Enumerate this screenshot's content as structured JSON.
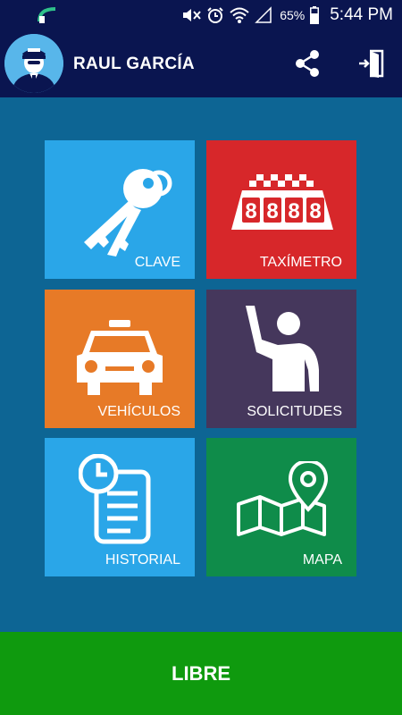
{
  "status_bar": {
    "battery": "65%",
    "time": "5:44 PM"
  },
  "header": {
    "user_name": "RAUL GARCÍA",
    "background": "#0a1550"
  },
  "tiles": [
    {
      "label": "CLAVE",
      "icon": "keys-icon",
      "color": "#2aa6e8"
    },
    {
      "label": "TAXÍMETRO",
      "icon": "taximeter-icon",
      "color": "#d7272a"
    },
    {
      "label": "VEHÍCULOS",
      "icon": "taxi-car-icon",
      "color": "#e77a27"
    },
    {
      "label": "SOLICITUDES",
      "icon": "raised-hand-person-icon",
      "color": "#45375c"
    },
    {
      "label": "HISTORIAL",
      "icon": "clock-document-icon",
      "color": "#2aa6e8"
    },
    {
      "label": "MAPA",
      "icon": "map-pin-icon",
      "color": "#0f8c4a"
    }
  ],
  "bottom": {
    "status_label": "LIBRE",
    "color": "#0f9a0e"
  },
  "colors": {
    "page_background": "#0d6594"
  }
}
